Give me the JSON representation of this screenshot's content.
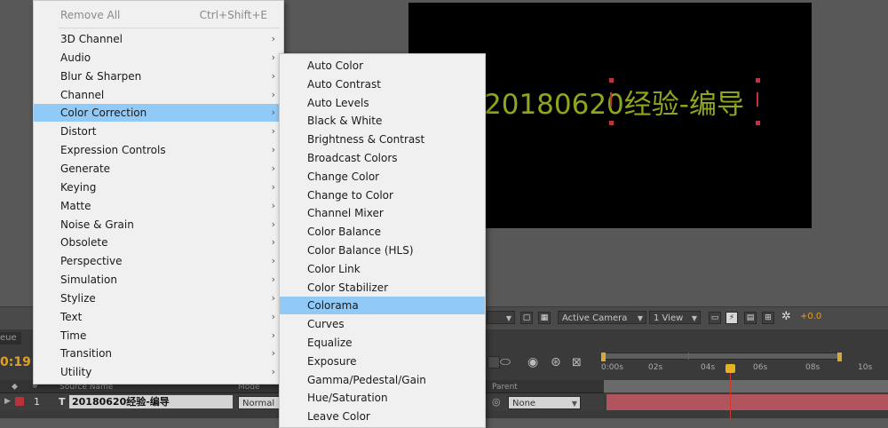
{
  "menu": {
    "remove_all": {
      "label": "Remove All",
      "shortcut": "Ctrl+Shift+E"
    },
    "items": [
      {
        "label": "3D Channel"
      },
      {
        "label": "Audio"
      },
      {
        "label": "Blur & Sharpen"
      },
      {
        "label": "Channel"
      },
      {
        "label": "Color Correction"
      },
      {
        "label": "Distort"
      },
      {
        "label": "Expression Controls"
      },
      {
        "label": "Generate"
      },
      {
        "label": "Keying"
      },
      {
        "label": "Matte"
      },
      {
        "label": "Noise & Grain"
      },
      {
        "label": "Obsolete"
      },
      {
        "label": "Perspective"
      },
      {
        "label": "Simulation"
      },
      {
        "label": "Stylize"
      },
      {
        "label": "Text"
      },
      {
        "label": "Time"
      },
      {
        "label": "Transition"
      },
      {
        "label": "Utility"
      }
    ],
    "highlighted": "Color Correction"
  },
  "submenu": {
    "items": [
      {
        "label": "Auto Color"
      },
      {
        "label": "Auto Contrast"
      },
      {
        "label": "Auto Levels"
      },
      {
        "label": "Black & White"
      },
      {
        "label": "Brightness & Contrast"
      },
      {
        "label": "Broadcast Colors"
      },
      {
        "label": "Change Color"
      },
      {
        "label": "Change to Color"
      },
      {
        "label": "Channel Mixer"
      },
      {
        "label": "Color Balance"
      },
      {
        "label": "Color Balance (HLS)"
      },
      {
        "label": "Color Link"
      },
      {
        "label": "Color Stabilizer"
      },
      {
        "label": "Colorama"
      },
      {
        "label": "Curves"
      },
      {
        "label": "Equalize"
      },
      {
        "label": "Exposure"
      },
      {
        "label": "Gamma/Pedestal/Gain"
      },
      {
        "label": "Hue/Saturation"
      },
      {
        "label": "Leave Color"
      }
    ],
    "highlighted": "Colorama"
  },
  "composition": {
    "text": "20180620经验-编导",
    "text_color": "#8fa61c",
    "background": "#000000"
  },
  "viewer_toolbar": {
    "camera": "Active Camera",
    "views": "1 View",
    "exposure": "+0.0"
  },
  "timeline": {
    "tab": "eue",
    "current_time": "0:19",
    "columns": {
      "source_name": "Source Name",
      "mode": "Mode",
      "parent": "Parent",
      "number": "#"
    },
    "layer": {
      "index": "1",
      "type": "T",
      "name": "20180620经验-编导",
      "mode": "Normal",
      "parent": "None"
    },
    "ruler_ticks": [
      "0:00s",
      "02s",
      "04s",
      "06s",
      "08s",
      "10s"
    ],
    "playhead_time_s": 4.8
  },
  "colors": {
    "menu_highlight": "#91c9f7",
    "track": "#b0545e",
    "timecode": "#e0a028"
  }
}
